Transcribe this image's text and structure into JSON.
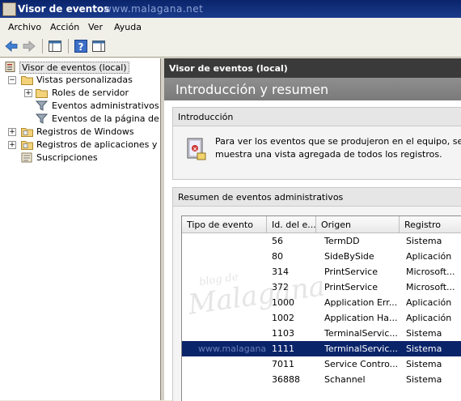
{
  "window": {
    "title": "Visor de eventos",
    "watermark": "www.malagana.net",
    "colors": {
      "titlebar": "#0a246a",
      "selection": "#0a246a",
      "panel_header": "#3a3a3a"
    }
  },
  "menu": [
    "Archivo",
    "Acción",
    "Ver",
    "Ayuda"
  ],
  "toolbar": {
    "icons": [
      "back-arrow-icon",
      "forward-arrow-icon",
      "show-hide-tree-icon",
      "help-icon",
      "action-pane-icon"
    ]
  },
  "tree": {
    "root": "Visor de eventos (local)",
    "custom_views": "Vistas personalizadas",
    "server_roles": "Roles de servidor",
    "admin_events": "Eventos administrativos",
    "page_events": "Eventos de la página de res",
    "windows_logs": "Registros de Windows",
    "app_service_logs": "Registros de aplicaciones y serv",
    "subscriptions": "Suscripciones"
  },
  "right": {
    "header": "Visor de eventos (local)",
    "big_title": "Introducción y resumen",
    "intro": {
      "title": "Introducción",
      "text_line1": "Para ver los eventos que se produjeron en el equipo, selec",
      "text_line2": "muestra una vista agregada de todos los registros."
    },
    "summary": {
      "title": "Resumen de eventos administrativos",
      "columns": [
        "Tipo de evento",
        "Id. del e...",
        "Origen",
        "Registro"
      ],
      "rows": [
        {
          "id": "56",
          "source": "TermDD",
          "log": "Sistema"
        },
        {
          "id": "80",
          "source": "SideBySide",
          "log": "Aplicación"
        },
        {
          "id": "314",
          "source": "PrintService",
          "log": "Microsoft..."
        },
        {
          "id": "372",
          "source": "PrintService",
          "log": "Microsoft..."
        },
        {
          "id": "1000",
          "source": "Application Err...",
          "log": "Aplicación"
        },
        {
          "id": "1002",
          "source": "Application Ha...",
          "log": "Aplicación"
        },
        {
          "id": "1103",
          "source": "TerminalServic...",
          "log": "Sistema"
        },
        {
          "id": "1111",
          "source": "TerminalServic...",
          "log": "Sistema"
        },
        {
          "id": "7011",
          "source": "Service Contro...",
          "log": "Sistema"
        },
        {
          "id": "36888",
          "source": "Schannel",
          "log": "Sistema"
        }
      ],
      "selected_row": 7
    }
  }
}
